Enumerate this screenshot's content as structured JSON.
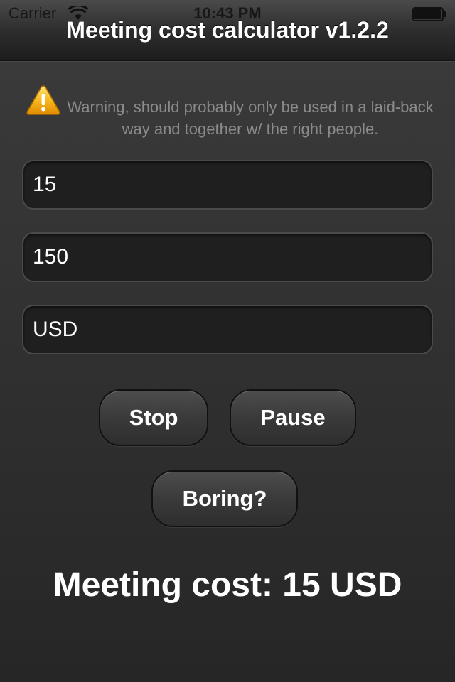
{
  "status_bar": {
    "carrier": "Carrier",
    "time": "10:43 PM",
    "wifi_icon": "wifi-icon",
    "battery_icon": "battery-icon"
  },
  "nav": {
    "title": "Meeting cost calculator v1.2.2"
  },
  "warning": {
    "icon": "warning-icon",
    "text": "Warning, should probably only be used in a laid-back way and together w/ the right people."
  },
  "fields": {
    "field_1_value": "15",
    "field_2_value": "150",
    "field_3_value": "USD"
  },
  "buttons": {
    "stop": "Stop",
    "pause": "Pause",
    "boring": "Boring?"
  },
  "result": {
    "text": "Meeting cost: 15 USD"
  },
  "colors": {
    "background": "#333333",
    "warning_text": "#8a8a8a",
    "warning_icon": "#f5b400"
  }
}
